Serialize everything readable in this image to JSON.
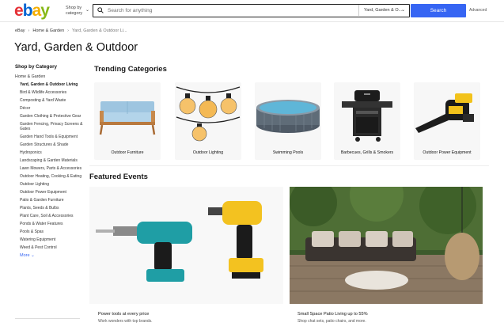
{
  "header": {
    "logo_letters": [
      "e",
      "b",
      "a",
      "y"
    ],
    "logo_colors": [
      "#e53238",
      "#0064d2",
      "#f5af02",
      "#86b817"
    ],
    "shop_by_line1": "Shop by",
    "shop_by_line2": "category",
    "search_placeholder": "Search for anything",
    "category_select": "Yard, Garden & O...",
    "search_button": "Search",
    "advanced": "Advanced"
  },
  "breadcrumb": [
    "eBay",
    "Home & Garden",
    "Yard, Garden & Outdoor Li..."
  ],
  "page_title": "Yard, Garden & Outdoor",
  "sidebar": {
    "heading": "Shop by Category",
    "parent": "Home & Garden",
    "items": [
      "Yard, Garden & Outdoor Living",
      "Bird & Wildlife Accessories",
      "Composting & Yard Waste",
      "Décor",
      "Garden Clothing & Protective Gear",
      "Garden Fencing, Privacy Screens & Gates",
      "Garden Hand Tools & Equipment",
      "Garden Structures & Shade",
      "Hydroponics",
      "Landscaping & Garden Materials",
      "Lawn Mowers, Parts & Accessories",
      "Outdoor Heating, Cooking & Eating",
      "Outdoor Lighting",
      "Outdoor Power Equipment",
      "Patio & Garden Furniture",
      "Plants, Seeds & Bulbs",
      "Plant Care, Soil & Accessories",
      "Ponds & Water Features",
      "Pools & Spas",
      "Watering Equipment",
      "Weed & Pest Control"
    ],
    "more": "More"
  },
  "trending": {
    "title": "Trending Categories",
    "categories": [
      {
        "label": "Outdoor Furniture",
        "icon": "sofa-image"
      },
      {
        "label": "Outdoor Lighting",
        "icon": "string-lights-image"
      },
      {
        "label": "Swimming Pools",
        "icon": "pool-image"
      },
      {
        "label": "Barbecues, Grills & Smokers",
        "icon": "grill-image"
      },
      {
        "label": "Outdoor Power Equipment",
        "icon": "leaf-blower-image"
      }
    ]
  },
  "featured": {
    "title": "Featured Events",
    "events": [
      {
        "title": "Power tools at every price",
        "subtitle": "Work wonders with top brands.",
        "image": "drills-image"
      },
      {
        "title": "Small Space Patio Living up to 55%",
        "subtitle": "Shop chat sets, patio chairs, and more.",
        "image": "patio-image"
      }
    ]
  },
  "colors": {
    "accent": "#3665f3",
    "text": "#111111"
  }
}
